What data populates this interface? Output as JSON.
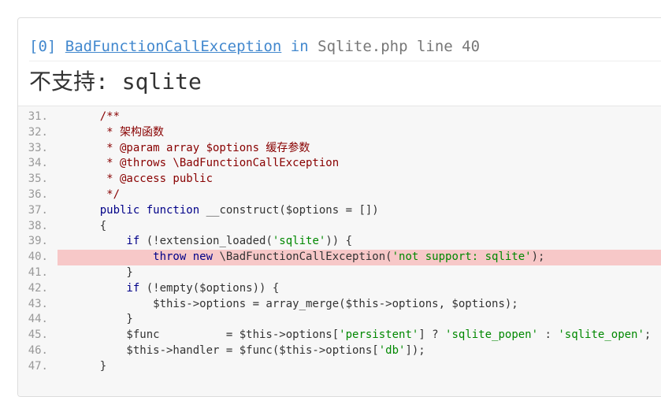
{
  "header": {
    "index": "[0]",
    "exception_class": "BadFunctionCallException",
    "in_word": "in",
    "file": "Sqlite.php",
    "line_label": "line 40"
  },
  "message": "不支持: sqlite",
  "code": {
    "highlight_line": "40.",
    "lines": [
      {
        "num": "31.",
        "tokens": [
          [
            "c",
            "    /**"
          ]
        ]
      },
      {
        "num": "32.",
        "tokens": [
          [
            "c",
            "     * 架构函数"
          ]
        ]
      },
      {
        "num": "33.",
        "tokens": [
          [
            "c",
            "     * @param array $options 缓存参数"
          ]
        ]
      },
      {
        "num": "34.",
        "tokens": [
          [
            "c",
            "     * @throws \\BadFunctionCallException"
          ]
        ]
      },
      {
        "num": "35.",
        "tokens": [
          [
            "c",
            "     * @access public"
          ]
        ]
      },
      {
        "num": "36.",
        "tokens": [
          [
            "c",
            "     */"
          ]
        ]
      },
      {
        "num": "37.",
        "tokens": [
          [
            "k",
            "    public function"
          ],
          [
            "p",
            " __construct($options = "
          ],
          [
            "p",
            "[])"
          ]
        ]
      },
      {
        "num": "38.",
        "tokens": [
          [
            "p",
            "    {"
          ]
        ]
      },
      {
        "num": "39.",
        "tokens": [
          [
            "k",
            "        if"
          ],
          [
            "p",
            " (!extension_loaded("
          ],
          [
            "s",
            "'sqlite'"
          ],
          [
            "p",
            ")) {"
          ]
        ]
      },
      {
        "num": "40.",
        "tokens": [
          [
            "k",
            "            throw new"
          ],
          [
            "p",
            " \\BadFunctionCallException("
          ],
          [
            "s",
            "'not support: sqlite'"
          ],
          [
            "p",
            ");"
          ]
        ]
      },
      {
        "num": "41.",
        "tokens": [
          [
            "p",
            "        }"
          ]
        ]
      },
      {
        "num": "42.",
        "tokens": [
          [
            "k",
            "        if"
          ],
          [
            "p",
            " (!empty($options)) {"
          ]
        ]
      },
      {
        "num": "43.",
        "tokens": [
          [
            "p",
            "            $this->options = array_merge($this->options, $options);"
          ]
        ]
      },
      {
        "num": "44.",
        "tokens": [
          [
            "p",
            "        }"
          ]
        ]
      },
      {
        "num": "45.",
        "tokens": [
          [
            "p",
            "        $func          = $this->options["
          ],
          [
            "s",
            "'persistent'"
          ],
          [
            "p",
            "] ? "
          ],
          [
            "s",
            "'sqlite_popen'"
          ],
          [
            "p",
            " : "
          ],
          [
            "s",
            "'sqlite_open'"
          ],
          [
            "p",
            ";"
          ]
        ]
      },
      {
        "num": "46.",
        "tokens": [
          [
            "p",
            "        $this->handler = $func($this->options["
          ],
          [
            "s",
            "'db'"
          ],
          [
            "p",
            "]);"
          ]
        ]
      },
      {
        "num": "47.",
        "tokens": [
          [
            "p",
            "    }"
          ]
        ]
      }
    ]
  }
}
